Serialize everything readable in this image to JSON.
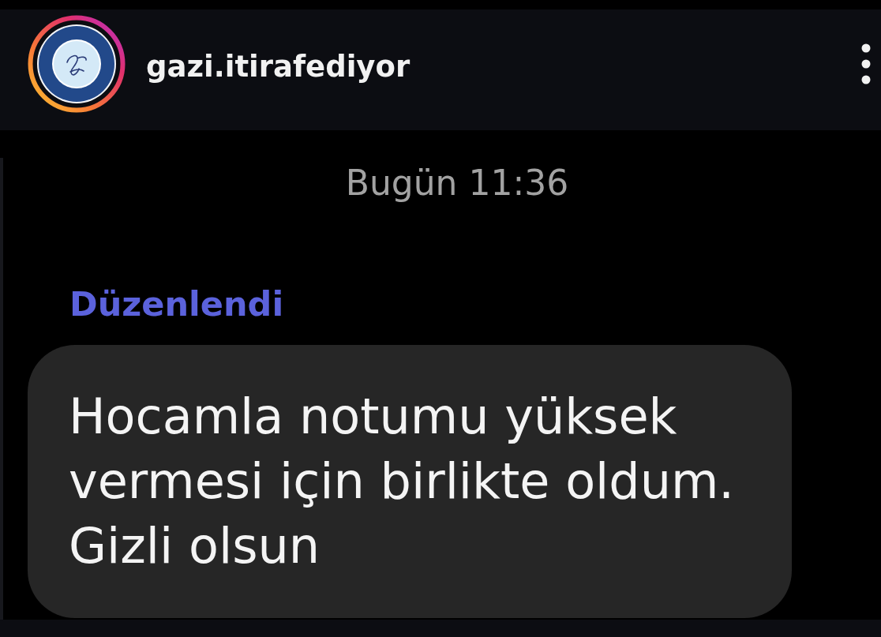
{
  "header": {
    "avatar": {
      "story_ring": true
    },
    "username": "gazi.itirafediyor"
  },
  "messages": [
    {
      "kind": "timestamp",
      "text": "Bugün 11:36"
    },
    {
      "kind": "incoming",
      "edited_label": "Düzenlendi",
      "text": "Hocamla notumu yüksek vermesi için birlikte oldum. Gizli olsun"
    }
  ]
}
